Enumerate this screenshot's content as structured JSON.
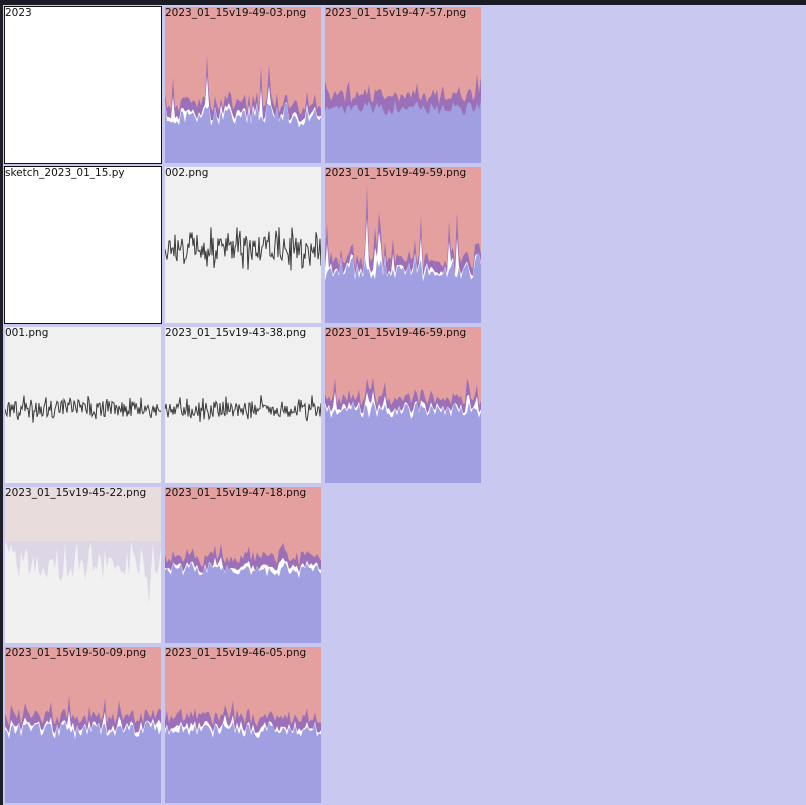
{
  "colors": {
    "background": "#c9c8f0",
    "thumb_top": "#e3a09e",
    "thumb_bottom": "#a09fe2",
    "thumb_streak": "#ffffff",
    "thumb_mid": "#9b70b8",
    "line_plot": "#3a3a3a",
    "pale_top": "#e8dcdc",
    "pale_bottom": "#f1f1f1"
  },
  "tiles": [
    {
      "label": "2023",
      "kind": "folder",
      "icon": "folder-icon"
    },
    {
      "label": "2023_01_15v19-49-03.png",
      "kind": "image",
      "style": "tall"
    },
    {
      "label": "2023_01_15v19-47-57.png",
      "kind": "image",
      "style": "flat"
    },
    {
      "label": "sketch_2023_01_15.py",
      "kind": "folder",
      "icon": "python-file-icon"
    },
    {
      "label": "002.png",
      "kind": "line",
      "style": "wide"
    },
    {
      "label": "2023_01_15v19-49-59.png",
      "kind": "image",
      "style": "tallest"
    },
    {
      "label": "001.png",
      "kind": "line",
      "style": "narrow"
    },
    {
      "label": "2023_01_15v19-43-38.png",
      "kind": "line",
      "style": "narrow"
    },
    {
      "label": "2023_01_15v19-46-59.png",
      "kind": "image",
      "style": "mid"
    },
    {
      "label": "2023_01_15v19-45-22.png",
      "kind": "pale",
      "style": "pale"
    },
    {
      "label": "2023_01_15v19-47-18.png",
      "kind": "image",
      "style": "low"
    },
    {
      "label": "2023_01_15v19-50-09.png",
      "kind": "image",
      "style": "lower"
    },
    {
      "label": "2023_01_15v19-46-05.png",
      "kind": "image",
      "style": "lowest"
    }
  ]
}
